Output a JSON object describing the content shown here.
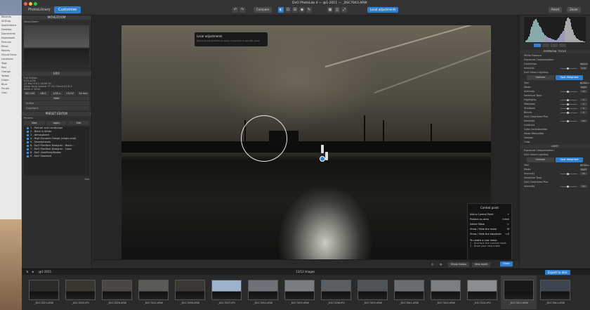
{
  "window": {
    "title": "DxO PhotoLab 4 — @1-2011 — _DSC7843.ARW"
  },
  "tabs": [
    {
      "label": "PhotoLibrary"
    },
    {
      "label": "Customize"
    }
  ],
  "toolbar": {
    "compare_label": "Compare",
    "local_adjustments_label": "Local adjustments",
    "reset_label": "Reset",
    "zoom_label": "Zoom"
  },
  "left_panel": {
    "move_zoom": {
      "title": "MOVE/ZOOM",
      "option_label": "Move/Zoom"
    },
    "exif": {
      "title": "EXIF",
      "file_edition": "Full Edition",
      "camera": "ILCE-A7III",
      "date": "13 Mar 2011 16:06:52",
      "lens": "Zeiss Vario-Sonnar T* 24-70mm f/2.8 Z",
      "dims": "6000 × 3000",
      "iso": "ISO 100",
      "aperture": "f/8.0",
      "shutter": "1/30 s",
      "exposure": "+0 EV",
      "focal": "24 mm",
      "format": "RAW",
      "author_label": "Author",
      "copyright_label": "Copyright"
    },
    "preset_editor": {
      "title": "PRESET EDITOR",
      "section_label": "Presets",
      "tab_new": "New",
      "tab_apply": "Apply",
      "tab_edit": "Edit"
    },
    "presets": [
      "1 - Portrait and Landscape",
      "2 - Black & White",
      "3 - Atmosphere",
      "4 - High Dynamic Range (single-shot)",
      "5 - Smartphones",
      "6 - DxO FilmPack Designer - Black...",
      "7 - DxO FilmPack Designer - Color",
      "8 - DxO ViewPoint/Modes",
      "9 - DxO Standard"
    ],
    "footer": "Sep"
  },
  "main": {
    "tooltip": {
      "title": "Local adjustments",
      "sub": "Use local adjustments to apply corrections to specific areas"
    },
    "control_point_menu": {
      "title": "Control point",
      "items": [
        {
          "label": "Add a Control Point",
          "key": "+"
        },
        {
          "label": "Protect an area",
          "key": "⇧click"
        },
        {
          "label": "Select Mask",
          "key": "⌥"
        },
        {
          "label": "Show / Hide the mask",
          "key": "M"
        },
        {
          "label": "Show / Hide the equalizer",
          "key": "⌥E"
        }
      ],
      "create_title": "To create a new mask:",
      "create_1": "1 - Uncheck the current mask",
      "create_2": "2 - Draw your new mask"
    },
    "bottom": {
      "show_masks": "Show masks",
      "new_mask": "New mask",
      "reset": "Reset",
      "close": "Close"
    }
  },
  "right_panel": {
    "sections": {
      "essential": "ESSENTIAL TOOLS",
      "light": "LIGHT"
    },
    "rows": [
      {
        "label": "White Balance"
      },
      {
        "label": "Exposure Compensation"
      },
      {
        "label": "Correction",
        "value": "Manual"
      },
      {
        "label": "Intensity",
        "value": "0.00"
      },
      {
        "label": "DxO Smart Lighting"
      },
      {
        "label": "Tool",
        "value": "No faces detected"
      },
      {
        "label": "Mode",
        "value": "Slight"
      },
      {
        "label": "Intensity",
        "value": "25"
      },
      {
        "label": "Selective Tone"
      },
      {
        "label": "Highlights",
        "value": "0"
      },
      {
        "label": "Midtones",
        "value": "0"
      },
      {
        "label": "Shadows",
        "value": "0"
      },
      {
        "label": "Blacks",
        "value": "0"
      },
      {
        "label": "DxO ClearView Plus"
      },
      {
        "label": "Intensity",
        "value": "50"
      },
      {
        "label": "Contrast"
      },
      {
        "label": "Color Accentuation"
      },
      {
        "label": "Noise Reduction"
      },
      {
        "label": "Horizon"
      },
      {
        "label": "Crop"
      }
    ],
    "light_rows": [
      {
        "label": "Exposure Compensation"
      },
      {
        "label": "DxO Smart Lighting"
      },
      {
        "label": "Tool",
        "value": "No faces detected"
      },
      {
        "label": "Mode",
        "value": "Slight"
      },
      {
        "label": "Intensity",
        "value": "25"
      },
      {
        "label": "Selective Tone"
      },
      {
        "label": "DxO ClearView Plus"
      },
      {
        "label": "Intensity",
        "value": "50"
      }
    ],
    "toggle": {
      "a": "Uniform",
      "b": "Spot Weighted"
    }
  },
  "filmstrip": {
    "folder": "@1-2011",
    "count": "13/13 images",
    "export_label": "Export to disk",
    "items": [
      "_DSC7823.ARW",
      "_DSC7825.JPG",
      "_DSC7828.ARW",
      "_DSC7832.ARW",
      "_DSC7836.ARW",
      "_DSC7837.JPG",
      "_DSC7834.ARW",
      "_DSC7835.ARW",
      "_DSC7838.JPG",
      "_DSC7839.ARW",
      "_DSC7841.ARW",
      "_DSC7840.ARW",
      "_DSC7842.JPG",
      "_DSC7843.ARW",
      "_DSC7844.ARW"
    ]
  },
  "finder": {
    "items": [
      "Recents",
      "AirDrop",
      "Applications",
      "Desktop",
      "Documents",
      "Downloads",
      "Pictures",
      "Music",
      "Movies",
      "iCloud Drive",
      "Locations",
      "Tags",
      "Red",
      "Orange",
      "Yellow",
      "Green",
      "Blue",
      "Purple",
      "Gray"
    ]
  },
  "colors": {
    "accent": "#2f7fd1",
    "bg": "#2b2b2b"
  }
}
